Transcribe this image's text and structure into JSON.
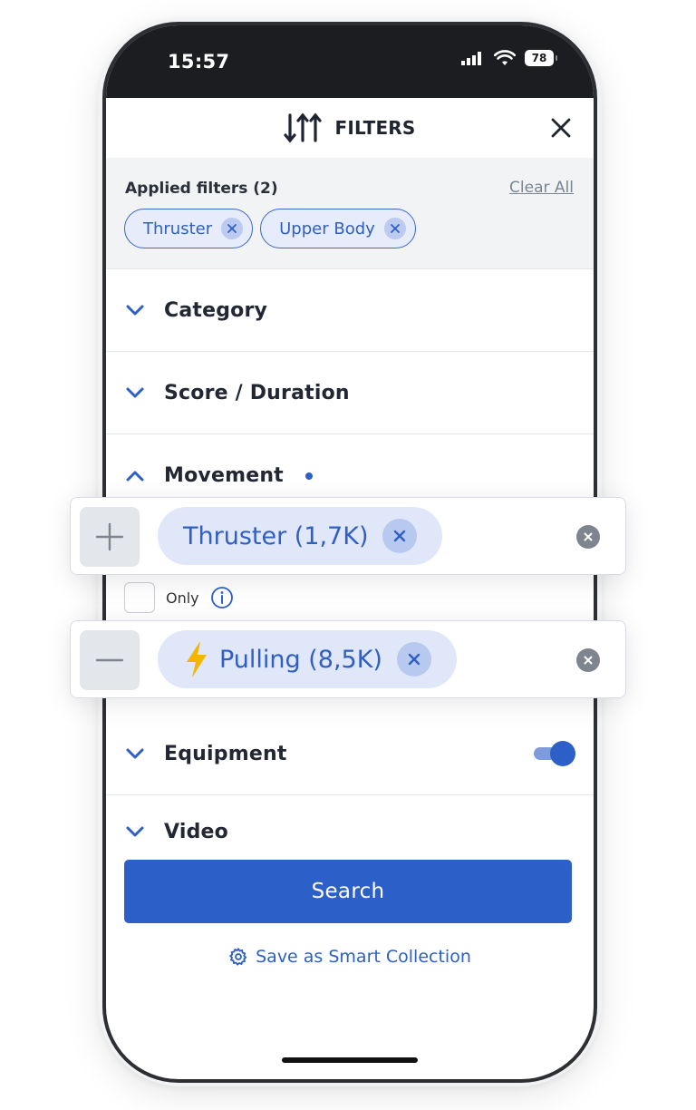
{
  "status_bar": {
    "time": "15:57",
    "battery": "78"
  },
  "header": {
    "title": "FILTERS",
    "icon": "sliders-icon",
    "close_icon": "close-icon"
  },
  "applied_filters": {
    "title": "Applied filters (2)",
    "clear_all": "Clear All",
    "chips": [
      {
        "label": "Thruster"
      },
      {
        "label": "Upper Body"
      }
    ]
  },
  "sections": {
    "category": "Category",
    "score_duration": "Score / Duration",
    "movement": "Movement",
    "equipment": "Equipment",
    "video": "Video"
  },
  "movement": {
    "only_label": "Only",
    "info_icon": "info-icon"
  },
  "equipment_toggle": {
    "on": true
  },
  "search_button": "Search",
  "save_link": {
    "label": "Save as Smart Collection",
    "icon": "gear-icon"
  },
  "floating_filters": [
    {
      "mode": "include",
      "mode_icon": "plus-icon",
      "label": "Thruster (1,7K)"
    },
    {
      "mode": "exclude",
      "mode_icon": "minus-icon",
      "label": "Pulling (8,5K)",
      "icon": "lightning-icon"
    }
  ],
  "colors": {
    "accent": "#2c5fc8",
    "chip_bg": "#e6ecf9",
    "lightning": "#f5b400"
  }
}
